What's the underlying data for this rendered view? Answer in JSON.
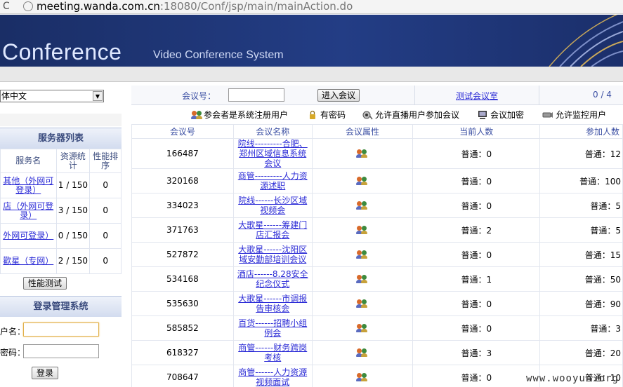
{
  "browser": {
    "url_main": "meeting.wanda.com.cn",
    "url_rest": ":18080/Conf/jsp/main/mainAction.do"
  },
  "banner": {
    "title": "Conference",
    "subtitle": "Video Conference System"
  },
  "left": {
    "language": "体中文",
    "server_list_title": "服务器列表",
    "server_headers": [
      "服务名",
      "资源统计",
      "性能排序"
    ],
    "servers": [
      {
        "name": "其他（外网可登录）",
        "res": "1 / 150",
        "rank": "0"
      },
      {
        "name": "店（外网可登录）",
        "res": "3 / 150",
        "rank": "0"
      },
      {
        "name": "外网可登录）",
        "res": "0 / 150",
        "rank": "0"
      },
      {
        "name": "歡星（专网）",
        "res": "2 / 150",
        "rank": "0"
      }
    ],
    "perf_test_button": "性能测试",
    "login_title": "登录管理系统",
    "username_label": "户名：",
    "password_label": "密码：",
    "login_button": "登录"
  },
  "right": {
    "meeting_no_label": "会议号：",
    "enter_button": "进入会议",
    "test_room_link": "测试会议室",
    "page_counter": "0 / 4",
    "legend": [
      {
        "icon": "people-icon",
        "label": "参会者是系统注册用户"
      },
      {
        "icon": "lock-icon",
        "label": "有密码"
      },
      {
        "icon": "broadcast-icon",
        "label": "允许直播用户参加会议"
      },
      {
        "icon": "encrypt-icon",
        "label": "会议加密"
      },
      {
        "icon": "camera-icon",
        "label": "允许监控用户"
      }
    ],
    "table_headers": [
      "会议号",
      "会议名称",
      "会议属性",
      "当前人数",
      "参加人数"
    ],
    "meetings": [
      {
        "id": "166487",
        "name_lines": [
          "院线---------合肥、",
          "郑州区域信息系统",
          "会议"
        ],
        "current": "普通：0",
        "join": "普通：12"
      },
      {
        "id": "320168",
        "name_lines": [
          "商管---------人力资",
          "源述职"
        ],
        "current": "普通：0",
        "join": "普通：100"
      },
      {
        "id": "334023",
        "name_lines": [
          "院线------长沙区域",
          "视频会"
        ],
        "current": "普通：0",
        "join": "普通：5"
      },
      {
        "id": "371763",
        "name_lines": [
          "大歌星------筹建门",
          "店汇报会"
        ],
        "current": "普通：2",
        "join": "普通：5"
      },
      {
        "id": "527872",
        "name_lines": [
          "大歌星------沈阳区",
          "域安勤部培训会议"
        ],
        "current": "普通：0",
        "join": "普通：15"
      },
      {
        "id": "534168",
        "name_lines": [
          "酒店------8.28安全",
          "纪念仪式"
        ],
        "current": "普通：1",
        "join": "普通：50"
      },
      {
        "id": "535630",
        "name_lines": [
          "大歌星------市调报",
          "告审核会"
        ],
        "current": "普通：0",
        "join": "普通：90"
      },
      {
        "id": "585852",
        "name_lines": [
          "百货------招聘小组",
          "例会"
        ],
        "current": "普通：0",
        "join": "普通：3"
      },
      {
        "id": "618327",
        "name_lines": [
          "商管------财务跨岗",
          "考核"
        ],
        "current": "普通：3",
        "join": "普通：20"
      },
      {
        "id": "708647",
        "name_lines": [
          "商管------人力资源",
          "视频面试"
        ],
        "current": "普通：0",
        "join": "普通：10"
      }
    ]
  },
  "watermark": "www.wooyun.org"
}
